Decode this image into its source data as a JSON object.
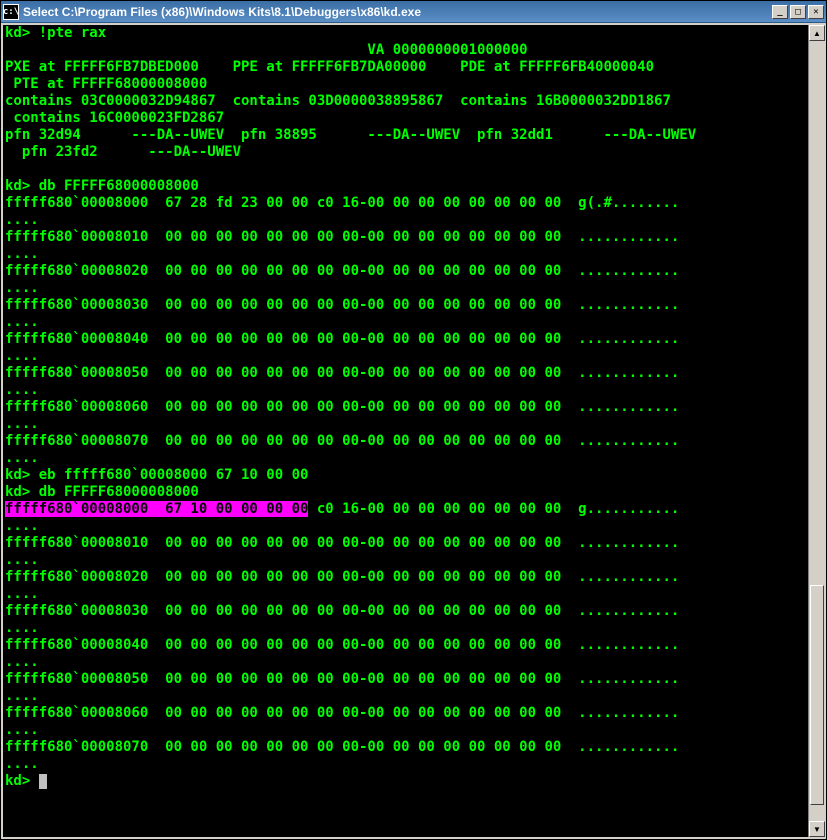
{
  "window": {
    "title": "Select C:\\Program Files (x86)\\Windows Kits\\8.1\\Debuggers\\x86\\kd.exe"
  },
  "prompt": "kd>",
  "lines": {
    "l1": "kd> !pte rax",
    "l2": "                                           VA 0000000001000000",
    "l3": "PXE at FFFFF6FB7DBED000    PPE at FFFFF6FB7DA00000    PDE at FFFFF6FB40000040",
    "l4": " PTE at FFFFF68000008000",
    "l5": "contains 03C0000032D94867  contains 03D0000038895867  contains 16B0000032DD1867",
    "l6": " contains 16C0000023FD2867",
    "l7": "pfn 32d94      ---DA--UWEV  pfn 38895      ---DA--UWEV  pfn 32dd1      ---DA--UWEV",
    "l8": "  pfn 23fd2      ---DA--UWEV",
    "l9": "",
    "l10": "kd> db FFFFF68000008000",
    "l11": "fffff680`00008000  67 28 fd 23 00 00 c0 16-00 00 00 00 00 00 00 00  g(.#........",
    "l12": "....",
    "l13": "fffff680`00008010  00 00 00 00 00 00 00 00-00 00 00 00 00 00 00 00  ............",
    "l14": "....",
    "l15": "fffff680`00008020  00 00 00 00 00 00 00 00-00 00 00 00 00 00 00 00  ............",
    "l16": "....",
    "l17": "fffff680`00008030  00 00 00 00 00 00 00 00-00 00 00 00 00 00 00 00  ............",
    "l18": "....",
    "l19": "fffff680`00008040  00 00 00 00 00 00 00 00-00 00 00 00 00 00 00 00  ............",
    "l20": "....",
    "l21": "fffff680`00008050  00 00 00 00 00 00 00 00-00 00 00 00 00 00 00 00  ............",
    "l22": "....",
    "l23": "fffff680`00008060  00 00 00 00 00 00 00 00-00 00 00 00 00 00 00 00  ............",
    "l24": "....",
    "l25": "fffff680`00008070  00 00 00 00 00 00 00 00-00 00 00 00 00 00 00 00  ............",
    "l26": "....",
    "l27": "kd> eb fffff680`00008000 67 10 00 00",
    "l28": "kd> db FFFFF68000008000",
    "l29a": "fffff680`00008000  67 10 00 00 00 00",
    "l29b": " c0 16-00 00 00 00 00 00 00 00  g...........",
    "l30": "....",
    "l31": "fffff680`00008010  00 00 00 00 00 00 00 00-00 00 00 00 00 00 00 00  ............",
    "l32": "....",
    "l33": "fffff680`00008020  00 00 00 00 00 00 00 00-00 00 00 00 00 00 00 00  ............",
    "l34": "....",
    "l35": "fffff680`00008030  00 00 00 00 00 00 00 00-00 00 00 00 00 00 00 00  ............",
    "l36": "....",
    "l37": "fffff680`00008040  00 00 00 00 00 00 00 00-00 00 00 00 00 00 00 00  ............",
    "l38": "....",
    "l39": "fffff680`00008050  00 00 00 00 00 00 00 00-00 00 00 00 00 00 00 00  ............",
    "l40": "....",
    "l41": "fffff680`00008060  00 00 00 00 00 00 00 00-00 00 00 00 00 00 00 00  ............",
    "l42": "....",
    "l43": "fffff680`00008070  00 00 00 00 00 00 00 00-00 00 00 00 00 00 00 00  ............",
    "l44": "....",
    "l45": "kd> "
  }
}
